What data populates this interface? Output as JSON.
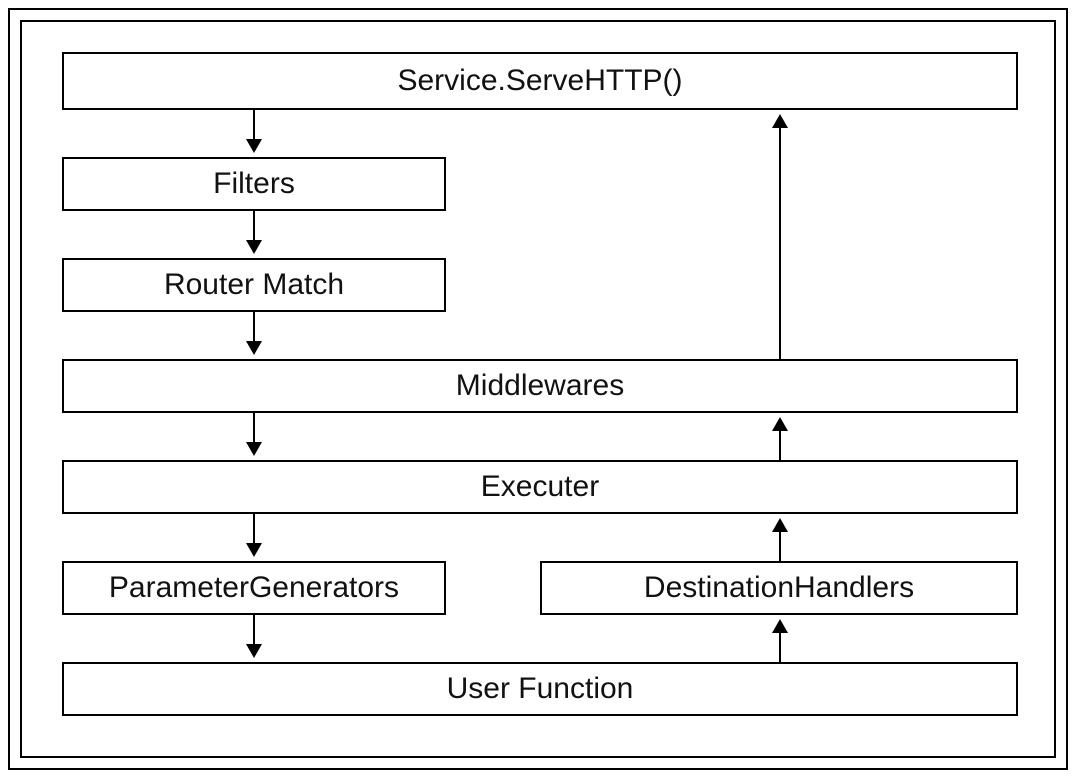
{
  "diagram": {
    "title": "Service.ServeHTTP()",
    "boxes": {
      "serve_http": "Service.ServeHTTP()",
      "filters": "Filters",
      "router_match": "Router Match",
      "middlewares": "Middlewares",
      "executer": "Executer",
      "parameter_generators": "ParameterGenerators",
      "destination_handlers": "DestinationHandlers",
      "user_function": "User Function"
    },
    "flow": [
      [
        "serve_http",
        "filters"
      ],
      [
        "filters",
        "router_match"
      ],
      [
        "router_match",
        "middlewares"
      ],
      [
        "middlewares",
        "executer"
      ],
      [
        "executer",
        "parameter_generators"
      ],
      [
        "parameter_generators",
        "user_function"
      ],
      [
        "user_function",
        "destination_handlers"
      ],
      [
        "destination_handlers",
        "executer"
      ],
      [
        "executer",
        "middlewares"
      ],
      [
        "middlewares",
        "serve_http"
      ]
    ]
  }
}
